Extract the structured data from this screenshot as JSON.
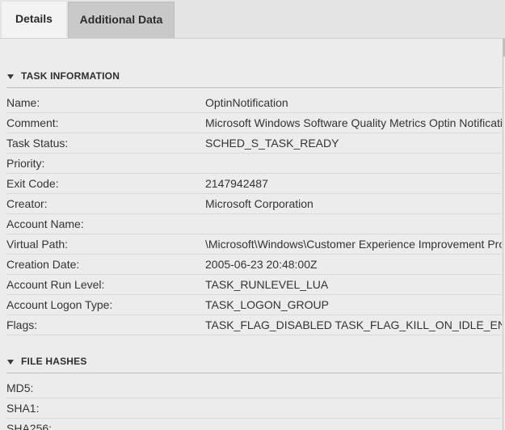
{
  "tabs": [
    {
      "label": "Details",
      "active": true
    },
    {
      "label": "Additional Data",
      "active": false
    }
  ],
  "task_information": {
    "title": "TASK INFORMATION",
    "rows": [
      {
        "label": "Name:",
        "value": "OptinNotification"
      },
      {
        "label": "Comment:",
        "value": "Microsoft Windows Software Quality Metrics Optin Notification"
      },
      {
        "label": "Task Status:",
        "value": "SCHED_S_TASK_READY"
      },
      {
        "label": "Priority:",
        "value": ""
      },
      {
        "label": "Exit Code:",
        "value": "2147942487"
      },
      {
        "label": "Creator:",
        "value": "Microsoft Corporation"
      },
      {
        "label": "Account Name:",
        "value": ""
      },
      {
        "label": "Virtual Path:",
        "value": "\\Microsoft\\Windows\\Customer Experience Improvement Program"
      },
      {
        "label": "Creation Date:",
        "value": "2005-06-23 20:48:00Z"
      },
      {
        "label": "Account Run Level:",
        "value": "TASK_RUNLEVEL_LUA"
      },
      {
        "label": "Account Logon Type:",
        "value": "TASK_LOGON_GROUP"
      },
      {
        "label": "Flags:",
        "value": "TASK_FLAG_DISABLED TASK_FLAG_KILL_ON_IDLE_END"
      }
    ]
  },
  "file_hashes": {
    "title": "FILE HASHES",
    "rows": [
      {
        "label": "MD5:",
        "value": ""
      },
      {
        "label": "SHA1:",
        "value": ""
      },
      {
        "label": "SHA256:",
        "value": ""
      }
    ]
  }
}
